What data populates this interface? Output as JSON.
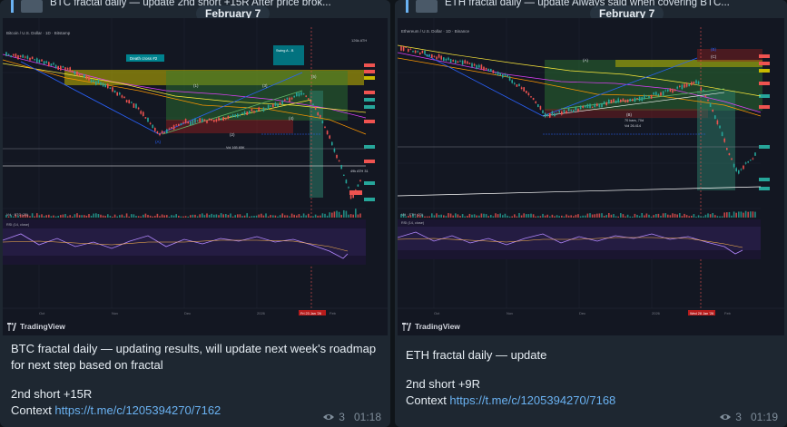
{
  "posts": [
    {
      "reply_preview": "BTC fractal daily — update  2nd short +15R  After price brok...",
      "date": "February 7",
      "chart": {
        "symbol": "Bitcoin / U.S. Dollar · 1D · Bitstamp",
        "label_top_right": "126k ATH",
        "annotations": {
          "death_cross": "Death cross #2",
          "swing_ab": "Swing A - B",
          "point_a": "(A)",
          "point_1": "(1)",
          "point_2": "(2)",
          "point_3": "(3)",
          "point_4": "(4)",
          "point_5": "(5)",
          "bars_info": "Vol 165.65K",
          "ath_label": "49k ATH 31",
          "date_marker": "Fri 23 Jan '26"
        },
        "x_ticks": [
          "Oct",
          "Nov",
          "Dec",
          "2026",
          "Feb"
        ],
        "indicator_labels": {
          "vol": "Vol · BTC (20)",
          "rsi": "RSI (14, close)"
        }
      },
      "tv_brand": "TradingView",
      "caption_line1": "BTC fractal daily — updating results, will update next week's roadmap for next step based on fractal",
      "caption_line2": "2nd short +15R",
      "context_label": "Context ",
      "context_link": "https://t.me/c/1205394270/7162",
      "views": "3",
      "time": "01:18"
    },
    {
      "reply_preview": "ETH fractal daily — update  Always said when covering BTC...",
      "date": "February 7",
      "chart": {
        "symbol": "Ethereum / U.S. Dollar · 1D · Binance",
        "annotations": {
          "point_a": "(A)",
          "point_b": "(B)",
          "point_b_top": "(B)",
          "point_c": "(C)",
          "bars_info": "70 bars, 70d",
          "vol_info": "Vol 26.414",
          "date_marker": "Wed 28 Jan '26"
        },
        "x_ticks": [
          "Oct",
          "Nov",
          "Dec",
          "2026",
          "Feb"
        ],
        "indicator_labels": {
          "vol": "Vol · ETH (20)",
          "rsi": "RSI (14, close)"
        }
      },
      "tv_brand": "TradingView",
      "caption_line1": "ETH fractal daily — update",
      "caption_line2": "2nd short +9R",
      "context_label": "Context ",
      "context_link": "https://t.me/c/1205394270/7168",
      "views": "3",
      "time": "01:19"
    }
  ],
  "colors": {
    "link": "#6ab2f2",
    "candle_up": "#26a69a",
    "candle_down": "#ef5350",
    "green_zone": "#2e7d32",
    "yellow_zone": "#c8b900"
  }
}
